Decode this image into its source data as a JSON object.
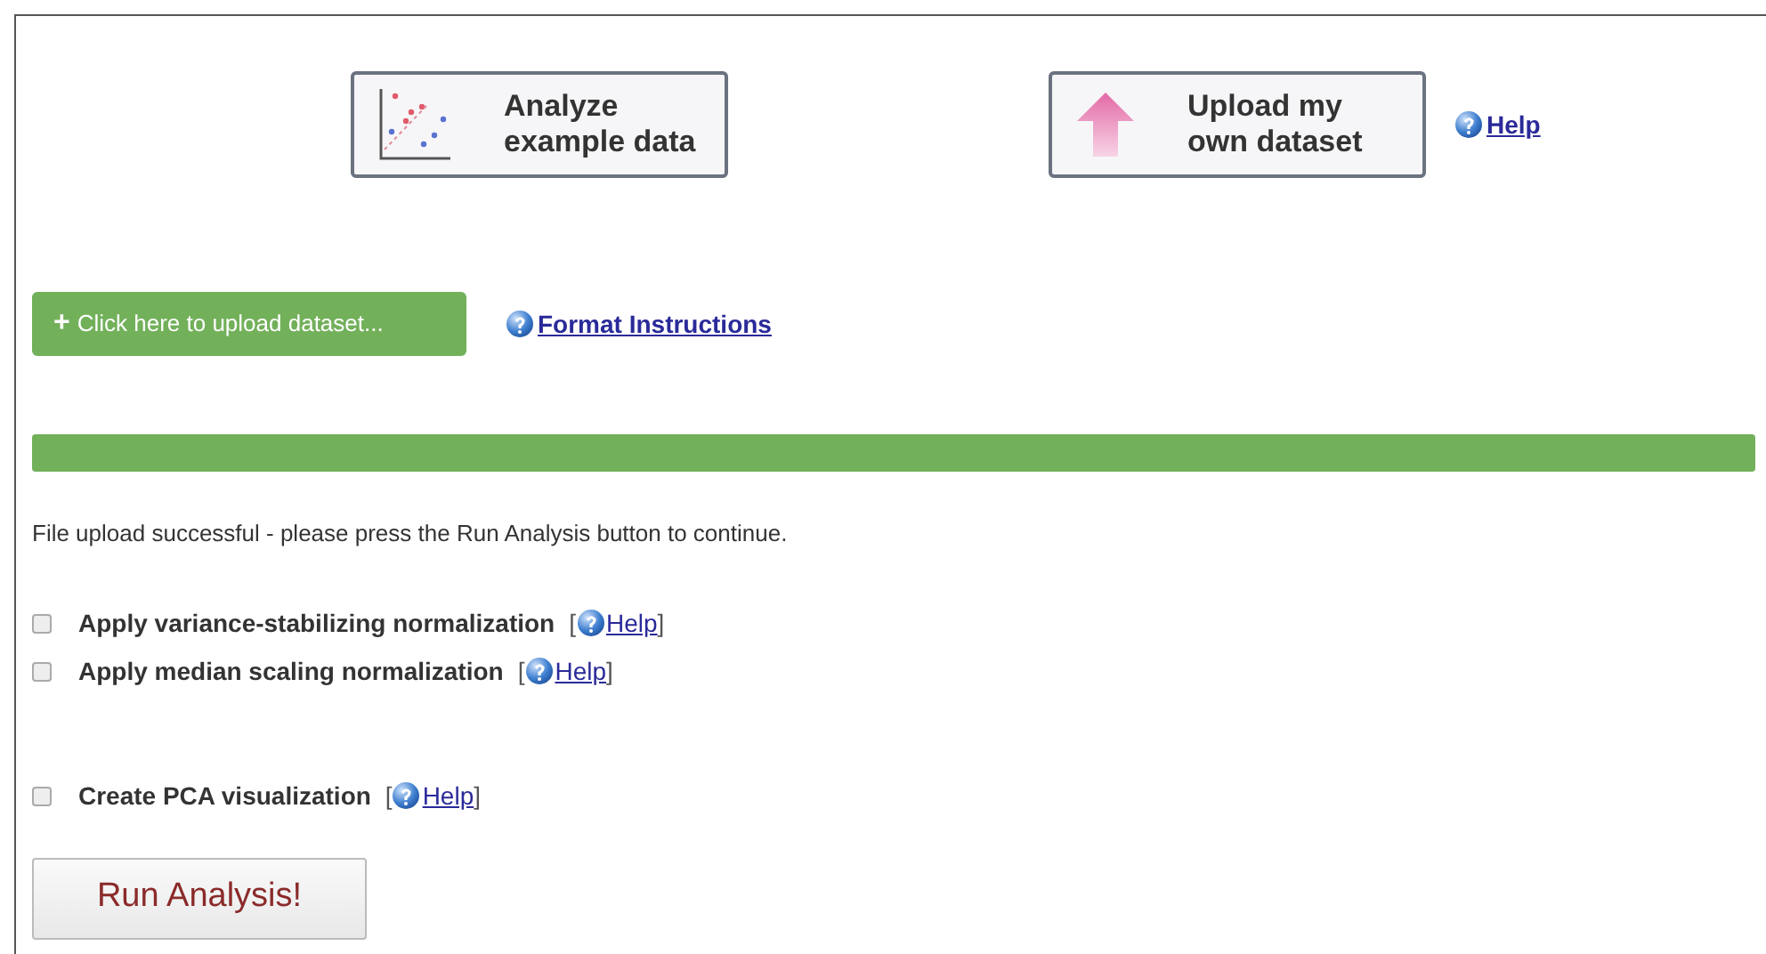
{
  "mode_buttons": [
    {
      "kind": "example",
      "label_lines": [
        "Analyze",
        "example data"
      ]
    },
    {
      "kind": "upload",
      "label_lines": [
        "Upload my",
        "own dataset"
      ]
    }
  ],
  "mode_help": "Help",
  "upload_button": {
    "icon": "+",
    "label": "Click here to upload dataset..."
  },
  "format_link": "Format Instructions",
  "progress": {
    "level": 1
  },
  "message": "File upload successful - please press the Run Analysis button to continue.",
  "options": [
    {
      "label": "Apply variance-stabilizing normalization",
      "checked": false,
      "bracket_open": "[",
      "help": "Help",
      "bracket_close": "]"
    },
    {
      "label": "Apply median scaling normalization",
      "checked": false,
      "bracket_open": "[",
      "help": "Help",
      "bracket_close": "]"
    },
    {
      "label": "Create PCA visualization",
      "checked": false,
      "bracket_open": "[",
      "help": "Help",
      "bracket_close": "]"
    }
  ],
  "run_button": "Run Analysis!"
}
